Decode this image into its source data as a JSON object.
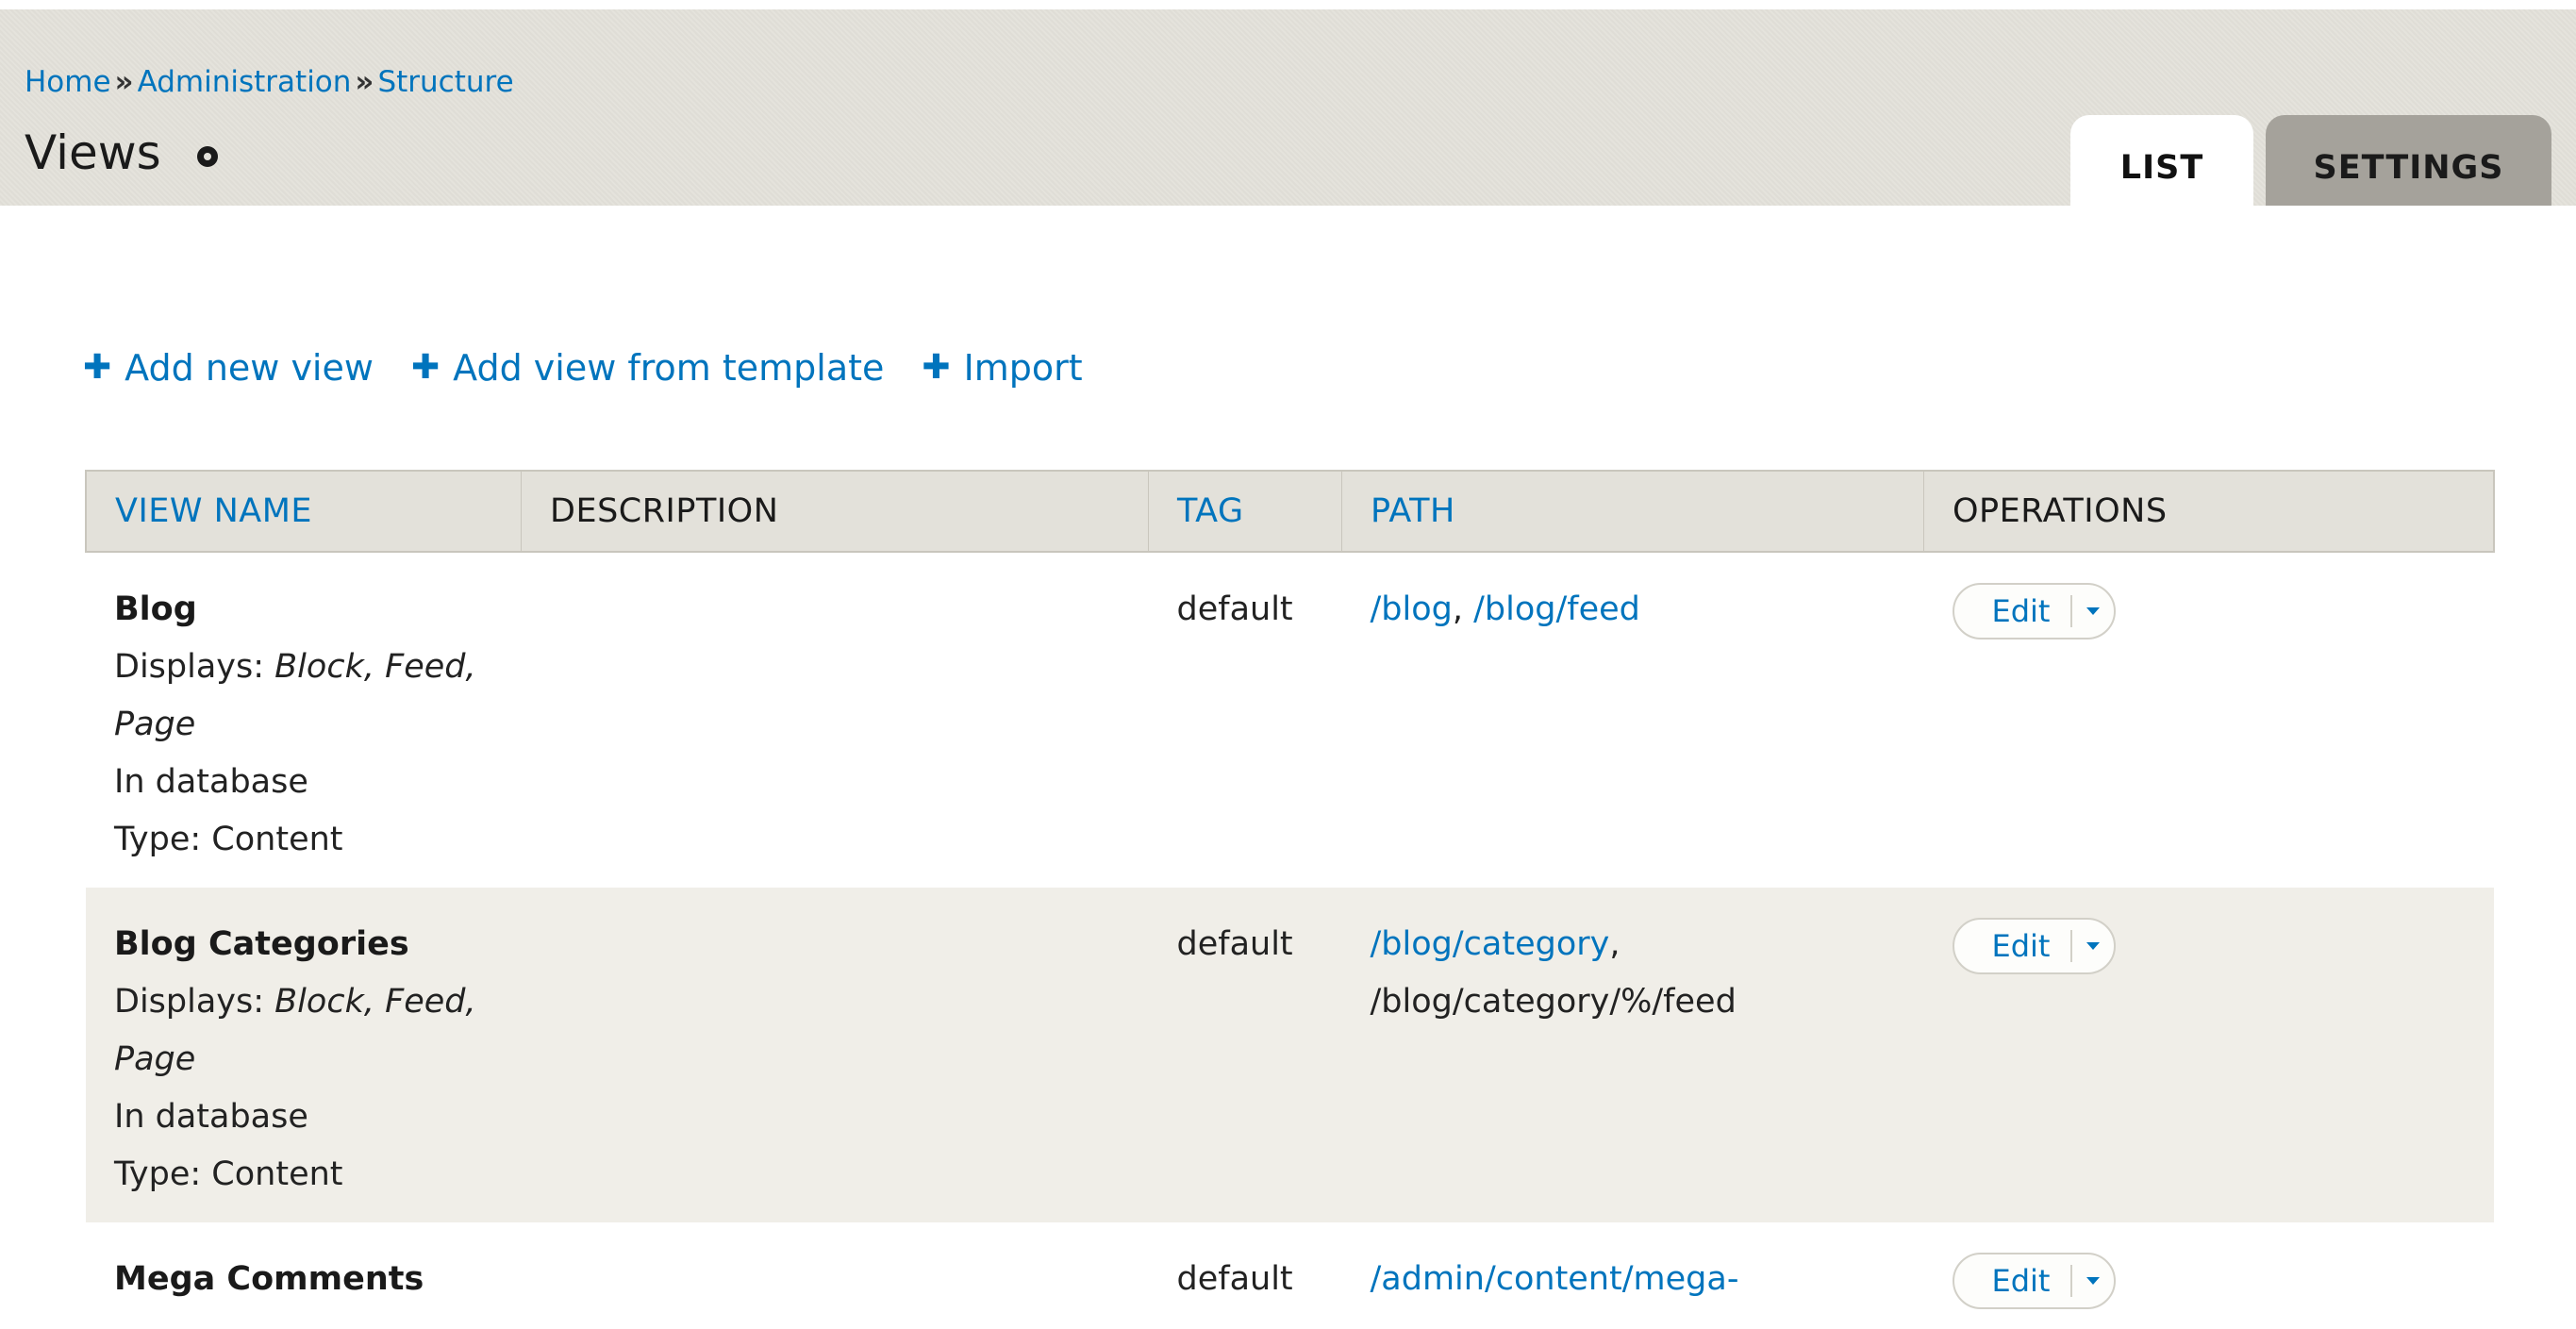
{
  "breadcrumb": {
    "items": [
      "Home",
      "Administration",
      "Structure"
    ],
    "separator": "»"
  },
  "page": {
    "title": "Views"
  },
  "tabs": [
    {
      "label": "LIST",
      "active": true
    },
    {
      "label": "SETTINGS",
      "active": false
    }
  ],
  "actions": [
    {
      "label": "Add new view"
    },
    {
      "label": "Add view from template"
    },
    {
      "label": "Import"
    }
  ],
  "table": {
    "headers": [
      "VIEW NAME",
      "DESCRIPTION",
      "TAG",
      "PATH",
      "OPERATIONS"
    ],
    "rows": [
      {
        "name": "Blog",
        "displays_prefix": "Displays: ",
        "displays_list": "Block, Feed,",
        "displays_list_2": "Page",
        "storage": "In database",
        "type": "Type: Content",
        "description": "",
        "tag": "default",
        "path_link_1": "/blog",
        "path_sep": ", ",
        "path_link_2": "/blog/feed",
        "operation": "Edit"
      },
      {
        "name": "Blog Categories",
        "displays_prefix": "Displays: ",
        "displays_list": "Block, Feed,",
        "displays_list_2": "Page",
        "storage": "In database",
        "type": "Type: Content",
        "description": "",
        "tag": "default",
        "path_link_1": "/blog/category",
        "path_sep": ",",
        "path_plain": "/blog/category/%/feed",
        "operation": "Edit"
      },
      {
        "name": "Mega Comments",
        "description": "",
        "tag": "default",
        "path_link_1": "/admin/content/mega-",
        "operation": "Edit"
      }
    ]
  },
  "colors": {
    "link": "#0074bd",
    "header_bg": "#e3e1da",
    "tab_inactive": "#a5a29b",
    "row_even": "#f0eee8"
  }
}
